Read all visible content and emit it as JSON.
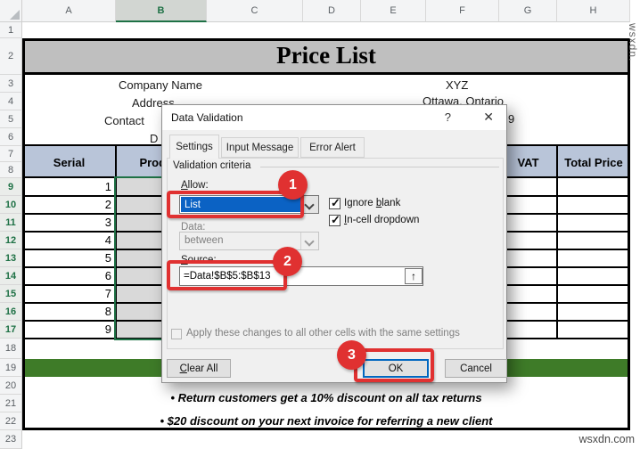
{
  "colors": {
    "annotation_red": "#e03131",
    "table_header_fill": "#b9c5d9",
    "title_fill": "#bfbfbf",
    "green_band": "#3e7b28",
    "excel_selection_green": "#1e7145",
    "combo_selection_blue": "#0b62c4",
    "ok_focus_blue": "#0067c0"
  },
  "spreadsheet": {
    "column_headers": [
      "A",
      "B",
      "C",
      "D",
      "E",
      "F",
      "G",
      "H"
    ],
    "selected_column": "B",
    "row_headers": [
      "1",
      "2",
      "3",
      "4",
      "5",
      "6",
      "7",
      "8",
      "9",
      "10",
      "11",
      "12",
      "13",
      "14",
      "15",
      "16",
      "17",
      "18",
      "19",
      "20",
      "21",
      "22",
      "23"
    ],
    "selected_rows_from": 9,
    "selected_rows_to": 17,
    "title": "Price List",
    "labels": {
      "company": "Company Name",
      "address": "Address",
      "contact": "Contact",
      "date_fragment": "D"
    },
    "values": {
      "company": "XYZ",
      "address": "Ottawa, Ontario",
      "phone_fragment": "9"
    },
    "table": {
      "serial_header": "Serial",
      "product_header": "Product",
      "vat_header": "VAT",
      "total_header": "Total Price",
      "serials": [
        "1",
        "2",
        "3",
        "4",
        "5",
        "6",
        "7",
        "8",
        "9"
      ]
    },
    "notes": [
      "• Return customers get a 10% discount on all tax returns",
      "• $20 discount on your next invoice for referring a new client"
    ]
  },
  "dialog": {
    "title": "Data Validation",
    "help_glyph": "?",
    "close_glyph": "✕",
    "tabs": [
      "Settings",
      "Input Message",
      "Error Alert"
    ],
    "active_tab": "Settings",
    "group_label": "Validation criteria",
    "allow_label": {
      "u": "A",
      "rest": "llow:"
    },
    "allow_value": "List",
    "ignore_blank": {
      "pre": "Ignore ",
      "u": "b",
      "rest": "lank"
    },
    "in_cell": {
      "u": "I",
      "rest": "n-cell dropdown"
    },
    "data_label": "Data:",
    "data_value": "between",
    "source_label": {
      "u": "S",
      "rest": "ource:"
    },
    "source_value": "=Data!$B$5:$B$13",
    "collapse_glyph": "↑",
    "apply_label": "Apply these changes to all other cells with the same settings",
    "buttons": {
      "clear_all": {
        "u": "C",
        "rest": "lear All"
      },
      "ok": "OK",
      "cancel": "Cancel"
    }
  },
  "annotations": {
    "steps": [
      "1",
      "2",
      "3"
    ]
  },
  "watermarks": {
    "side": "wsxdn.",
    "bottom": "wsxdn.com"
  }
}
